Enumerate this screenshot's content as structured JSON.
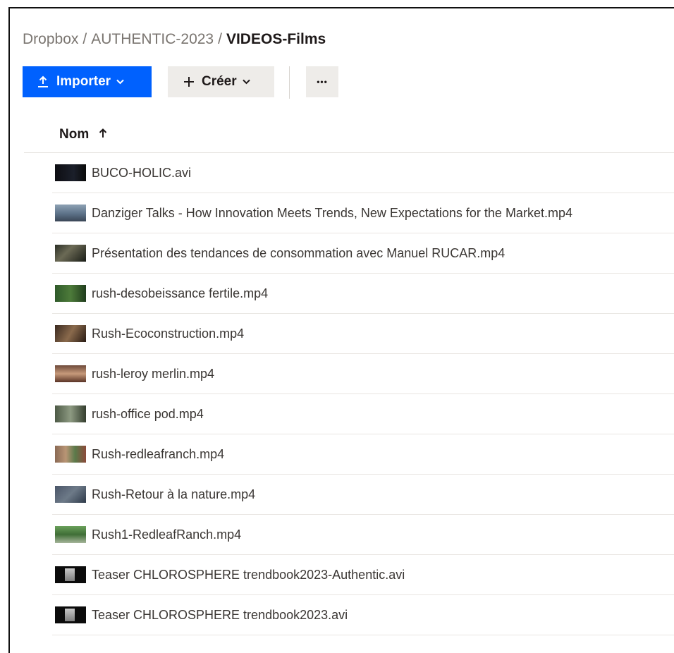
{
  "breadcrumb": {
    "root": "Dropbox",
    "parent": "AUTHENTIC-2023",
    "current": "VIDEOS-Films",
    "separator": "/"
  },
  "toolbar": {
    "import_label": "Importer",
    "create_label": "Créer",
    "more_label": "•••"
  },
  "table": {
    "column_name": "Nom",
    "sort_direction": "ascending"
  },
  "files": [
    {
      "name": "BUCO-HOLIC.avi",
      "thumb": "t-dark"
    },
    {
      "name": "Danziger Talks - How Innovation Meets Trends, New Expectations for the Market.mp4",
      "thumb": "t-panel"
    },
    {
      "name": "Présentation des tendances de consommation avec Manuel RUCAR.mp4",
      "thumb": "t-forest"
    },
    {
      "name": "rush-desobeissance fertile.mp4",
      "thumb": "t-green"
    },
    {
      "name": "Rush-Ecoconstruction.mp4",
      "thumb": "t-wood"
    },
    {
      "name": "rush-leroy merlin.mp4",
      "thumb": "t-brick"
    },
    {
      "name": "rush-office pod.mp4",
      "thumb": "t-office"
    },
    {
      "name": "Rush-redleafranch.mp4",
      "thumb": "t-ranch"
    },
    {
      "name": "Rush-Retour à la nature.mp4",
      "thumb": "t-nature"
    },
    {
      "name": "Rush1-RedleafRanch.mp4",
      "thumb": "t-ranch2"
    },
    {
      "name": "Teaser CHLOROSPHERE trendbook2023-Authentic.avi",
      "thumb": "t-teaser"
    },
    {
      "name": "Teaser CHLOROSPHERE trendbook2023.avi",
      "thumb": "t-teaser"
    }
  ],
  "colors": {
    "primary": "#0061fe",
    "secondary_button": "#eeece9",
    "text": "#1e1919",
    "muted_text": "#7a7570"
  }
}
